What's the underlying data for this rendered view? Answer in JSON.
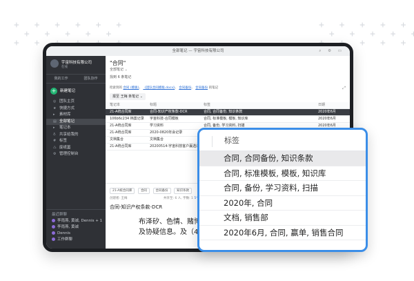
{
  "window": {
    "title": "全部笔记 — 宇宙科技有限公司",
    "toolbar_icons": "⌕ ⚙ ▭"
  },
  "sidebar": {
    "org_name": "宇宙科技有限公司",
    "org_sub": "在线",
    "tabs": [
      "我的工作",
      "团队协作"
    ],
    "new_note": "新建笔记",
    "items": [
      {
        "icon": "◎",
        "label": "团队主页",
        "state": "normal"
      },
      {
        "icon": "★",
        "label": "快捷方式",
        "state": "normal"
      },
      {
        "icon": "▸",
        "label": "素材库",
        "state": "normal"
      },
      {
        "icon": "▤",
        "label": "全部笔记",
        "state": "active"
      },
      {
        "icon": "▸",
        "label": "笔记本",
        "state": "normal"
      },
      {
        "icon": "♁",
        "label": "共享给我的",
        "state": "normal"
      },
      {
        "icon": "#",
        "label": "标签",
        "state": "normal"
      },
      {
        "icon": "♺",
        "label": "废纸篓",
        "state": "normal"
      },
      {
        "icon": "⚙",
        "label": "管理控制台",
        "state": "normal"
      }
    ],
    "recent_header": "最近群聊",
    "recent": [
      {
        "label": "李雨燕, 黄诚, Dennis + 1"
      },
      {
        "label": "李雨燕, 黄诚"
      },
      {
        "label": "Dennis"
      },
      {
        "label": "工作群聊"
      }
    ]
  },
  "main": {
    "title": "\"合同\"",
    "scope": "全部笔记 ⌄",
    "count": "找到 6 条笔记",
    "filter_prefix": "检索到的",
    "filter_links": [
      "合同 (模板)",
      "《团队合同模板.docx》",
      "合同备份",
      "合同备份"
    ],
    "filter_suffix": "的笔记",
    "owner": "报至 王梅 条笔记 ⌄",
    "columns": [
      "笔记本",
      "标题",
      "标签",
      "日期"
    ],
    "rows": [
      {
        "notebook": "21-A统合同库",
        "title": "合同-知识产权条款-DCR",
        "tags": "合同, 合同备份, 知识条款",
        "date": "2020年6月",
        "selected": true
      },
      {
        "notebook": "106b6c234 档案记录",
        "title": "宇宙科技-合同模板",
        "tags": "合同, 标准模板, 模板, 知识库",
        "date": "2020年6月",
        "selected": false
      },
      {
        "notebook": "21-A统合同库",
        "title": "学习资料",
        "tags": "合同, 备份, 学习资料, 扫描",
        "date": "2020年6月",
        "selected": false
      },
      {
        "notebook": "21-A统合同库",
        "title": "2020-0820年会记录",
        "tags": "2020年, 合同",
        "date": "2020年6月",
        "selected": false
      },
      {
        "notebook": "文档集合",
        "title": "文档集合",
        "tags": "文档, 销售部",
        "date": "2020年6月",
        "selected": false
      },
      {
        "notebook": "21-A统合同库",
        "title": "20200514-宇宙科技客户赢选内容",
        "tags": "2020年6月, 合同, 赢单",
        "date": "2020年6月",
        "selected": false
      }
    ]
  },
  "editor": {
    "chips": [
      "21-A统合同库",
      "合同",
      "合同备份",
      "知识条款"
    ],
    "meta_left": "创建者: 王梅",
    "meta_right": "共享至: 6 人, 字数: 1",
    "meta_link": "5个群聊",
    "doc_title": "合同-知识产权条款-DCR",
    "body_lines": [
      "布泽矽、色情、赌博、",
      "及协疑信息。及（4）"
    ]
  },
  "tag_popup": {
    "header": "标签",
    "rows": [
      {
        "label": "合同, 合同备份, 知识条款",
        "selected": true
      },
      {
        "label": "合同, 标准模板, 模板, 知识库",
        "selected": false
      },
      {
        "label": "合同, 备份, 学习资料, 扫描",
        "selected": false
      },
      {
        "label": "2020年, 合同",
        "selected": false
      },
      {
        "label": "文档, 销售部",
        "selected": false
      },
      {
        "label": "2020年6月, 合同, 赢单, 销售合同",
        "selected": false
      }
    ]
  }
}
